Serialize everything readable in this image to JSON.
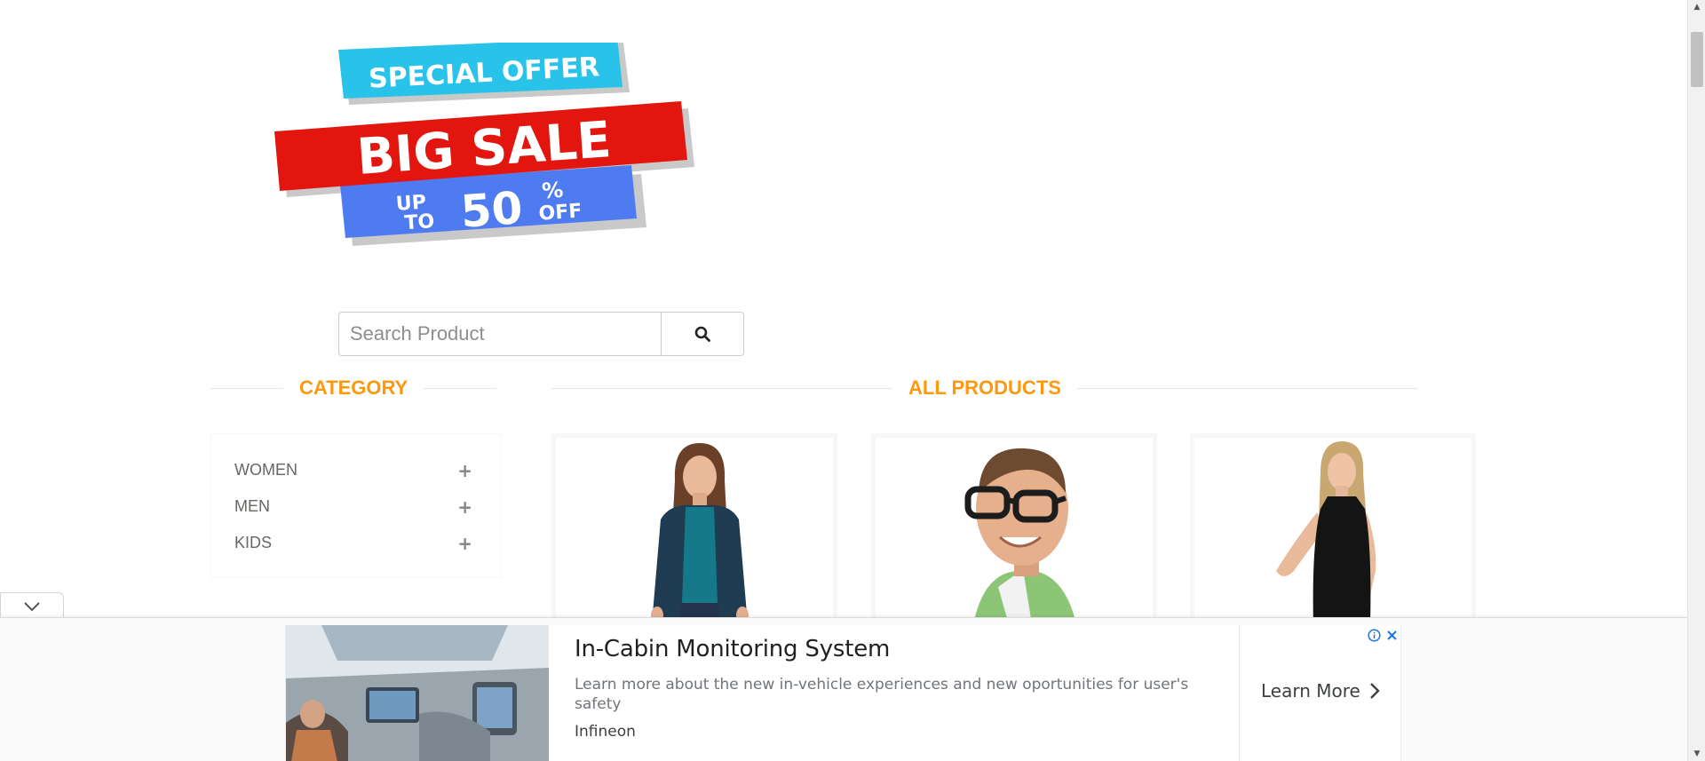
{
  "banner": {
    "line1": "SPECIAL OFFER",
    "line2": "BIG SALE",
    "up": "UP",
    "to": "TO",
    "amount": "50",
    "percent": "%",
    "off": "OFF"
  },
  "search": {
    "placeholder": "Search Product"
  },
  "category": {
    "title": "CATEGORY",
    "items": [
      {
        "label": "WOMEN"
      },
      {
        "label": "MEN"
      },
      {
        "label": "KIDS"
      }
    ]
  },
  "products": {
    "title": "ALL PRODUCTS"
  },
  "ad": {
    "headline": "In-Cabin Monitoring System",
    "description": "Learn more about the new in-vehicle experiences and new oportunities for user's safety",
    "advertiser": "Infineon",
    "cta": "Learn More"
  },
  "colors": {
    "accent": "#fe980f",
    "banner_cyan": "#29c3ea",
    "banner_red": "#e3150f",
    "banner_blue": "#4f7bf0"
  },
  "icons": [
    "search-icon",
    "plus-icon",
    "chevron-down-icon",
    "chevron-right-icon",
    "info-icon",
    "close-icon"
  ]
}
